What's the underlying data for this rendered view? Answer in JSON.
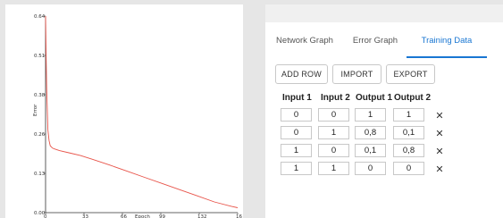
{
  "chart_data": {
    "type": "line",
    "xlabel": "Epoch",
    "ylabel": "Error",
    "xlim": [
      0,
      165
    ],
    "ylim": [
      0,
      0.64
    ],
    "x_ticks": [
      "0",
      "33",
      "66",
      "99",
      "132",
      "16"
    ],
    "y_ticks": [
      "0.00",
      "0.13",
      "0.26",
      "0.38",
      "0.51",
      "0.64"
    ],
    "series": [
      {
        "color": "#e8544a",
        "x": [
          0,
          0.5,
          1,
          1.5,
          2,
          3,
          4,
          6,
          8,
          12,
          20,
          30,
          40,
          55,
          70,
          85,
          100,
          115,
          130,
          145,
          160,
          165
        ],
        "y": [
          0.64,
          0.5,
          0.4,
          0.33,
          0.27,
          0.235,
          0.218,
          0.21,
          0.207,
          0.202,
          0.195,
          0.186,
          0.174,
          0.155,
          0.135,
          0.115,
          0.095,
          0.075,
          0.055,
          0.035,
          0.02,
          0.016
        ]
      }
    ]
  },
  "tabs": [
    "Network Graph",
    "Error Graph",
    "Training Data"
  ],
  "buttons": {
    "add_row": "ADD ROW",
    "import": "IMPORT",
    "export": "EXPORT"
  },
  "columns": [
    "Input 1",
    "Input 2",
    "Output 1",
    "Output 2"
  ],
  "rows": [
    [
      "0",
      "0",
      "1",
      "1"
    ],
    [
      "0",
      "1",
      "0,8",
      "0,1"
    ],
    [
      "1",
      "0",
      "0,1",
      "0,8"
    ],
    [
      "1",
      "1",
      "0",
      "0"
    ]
  ],
  "delete_glyph": "✕"
}
